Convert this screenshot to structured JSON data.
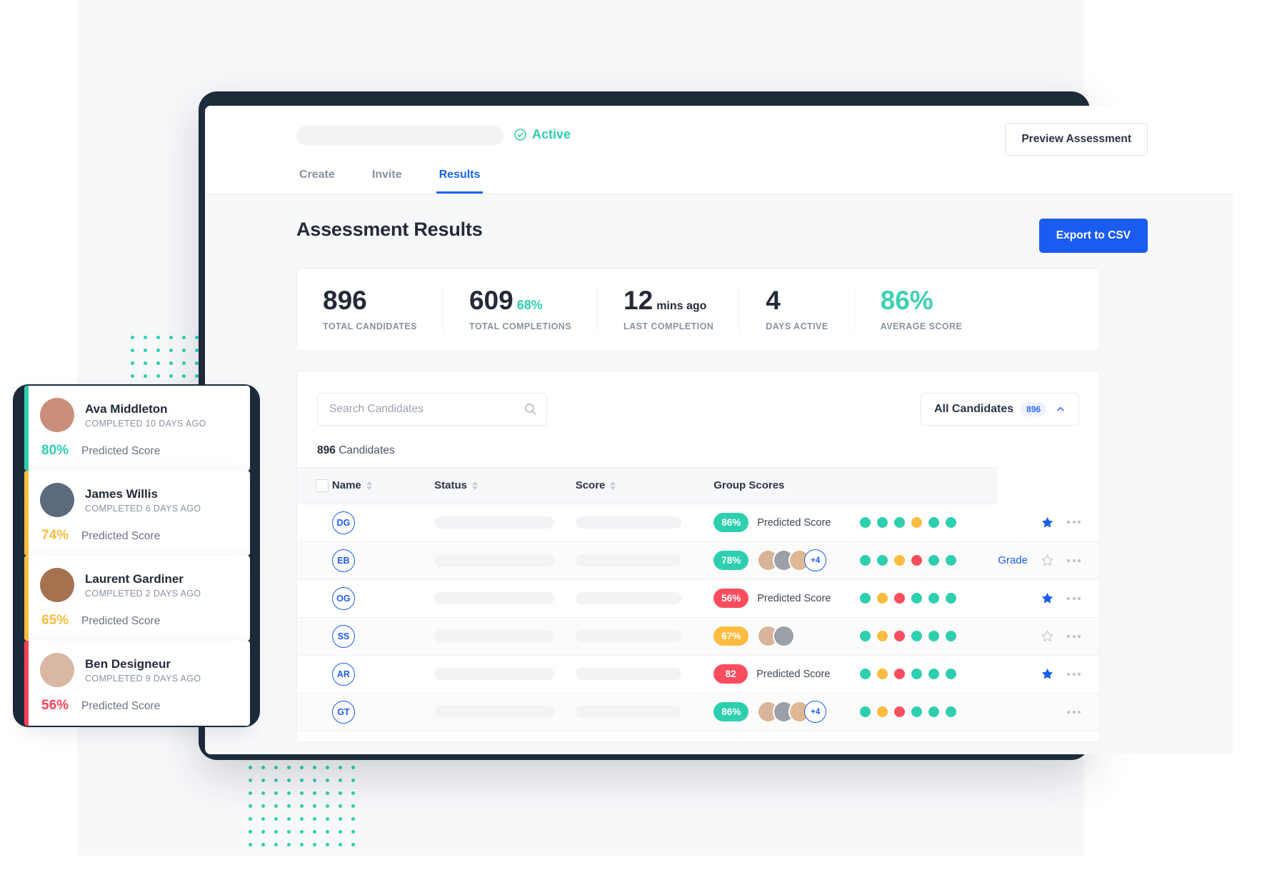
{
  "header": {
    "status_label": "Active",
    "preview_button": "Preview Assessment",
    "tabs": [
      {
        "label": "Create",
        "active": false
      },
      {
        "label": "Invite",
        "active": false
      },
      {
        "label": "Results",
        "active": true
      }
    ]
  },
  "main": {
    "page_title": "Assessment Results",
    "export_button": "Export to CSV"
  },
  "stats": [
    {
      "value": "896",
      "suffix": "",
      "label": "TOTAL CANDIDATES",
      "accent": false
    },
    {
      "value": "609",
      "suffix": "68%",
      "label": "TOTAL COMPLETIONS",
      "accent": false
    },
    {
      "value": "12",
      "suffix": "mins ago",
      "label": "LAST COMPLETION",
      "accent": false
    },
    {
      "value": "4",
      "suffix": "",
      "label": "DAYS ACTIVE",
      "accent": false
    },
    {
      "value": "86%",
      "suffix": "",
      "label": "AVERAGE SCORE",
      "accent": true
    }
  ],
  "toolbar": {
    "search_placeholder": "Search Candidates",
    "search_value": "",
    "filter_label": "All Candidates",
    "filter_count": "896"
  },
  "table": {
    "count_number": "896",
    "count_word": "Candidates",
    "columns": [
      {
        "label": "Name",
        "sortable": true
      },
      {
        "label": "Status",
        "sortable": true
      },
      {
        "label": "Score",
        "sortable": true
      },
      {
        "label": "Group Scores",
        "sortable": false
      }
    ],
    "rows": [
      {
        "initials": "DG",
        "score": "86%",
        "score_color": "teal",
        "score_label": "Predicted Score",
        "graders": 0,
        "grader_extra": "",
        "dots": [
          "teal",
          "teal",
          "teal",
          "amber",
          "teal",
          "teal"
        ],
        "grade_link": "",
        "starred": true
      },
      {
        "initials": "EB",
        "score": "78%",
        "score_color": "teal",
        "score_label": "",
        "graders": 3,
        "grader_extra": "+4",
        "dots": [
          "teal",
          "teal",
          "amber",
          "red",
          "teal",
          "teal"
        ],
        "grade_link": "Grade",
        "starred": false
      },
      {
        "initials": "OG",
        "score": "56%",
        "score_color": "red",
        "score_label": "Predicted Score",
        "graders": 0,
        "grader_extra": "",
        "dots": [
          "teal",
          "amber",
          "red",
          "teal",
          "teal",
          "teal"
        ],
        "grade_link": "",
        "starred": true
      },
      {
        "initials": "SS",
        "score": "67%",
        "score_color": "amber",
        "score_label": "",
        "graders": 2,
        "grader_extra": "",
        "dots": [
          "teal",
          "amber",
          "red",
          "teal",
          "teal",
          "teal"
        ],
        "grade_link": "",
        "starred": false
      },
      {
        "initials": "AR",
        "score": "82",
        "score_color": "red",
        "score_label": "Predicted Score",
        "graders": 0,
        "grader_extra": "",
        "dots": [
          "teal",
          "amber",
          "red",
          "teal",
          "teal",
          "teal"
        ],
        "grade_link": "",
        "starred": true
      },
      {
        "initials": "GT",
        "score": "86%",
        "score_color": "teal",
        "score_label": "",
        "graders": 3,
        "grader_extra": "+4",
        "dots": [
          "teal",
          "amber",
          "red",
          "teal",
          "teal",
          "teal"
        ],
        "grade_link": "",
        "starred": null
      }
    ]
  },
  "candidate_cards": [
    {
      "name": "Ava Middleton",
      "meta": "COMPLETED 10 DAYS AGO",
      "score": "80%",
      "score_label": "Predicted Score",
      "color": "teal"
    },
    {
      "name": "James Willis",
      "meta": "COMPLETED 6 DAYS AGO",
      "score": "74%",
      "score_label": "Predicted Score",
      "color": "amber"
    },
    {
      "name": "Laurent Gardiner",
      "meta": "COMPLETED 2 DAYS AGO",
      "score": "65%",
      "score_label": "Predicted Score",
      "color": "amber"
    },
    {
      "name": "Ben Designeur",
      "meta": "COMPLETED 9 DAYS AGO",
      "score": "56%",
      "score_label": "Predicted Score",
      "color": "red"
    }
  ],
  "colors": {
    "teal": "#2ecfae",
    "amber": "#fbbc3f",
    "red": "#fa4d5e",
    "blue": "#1b5cf0",
    "dark": "#232b38"
  }
}
